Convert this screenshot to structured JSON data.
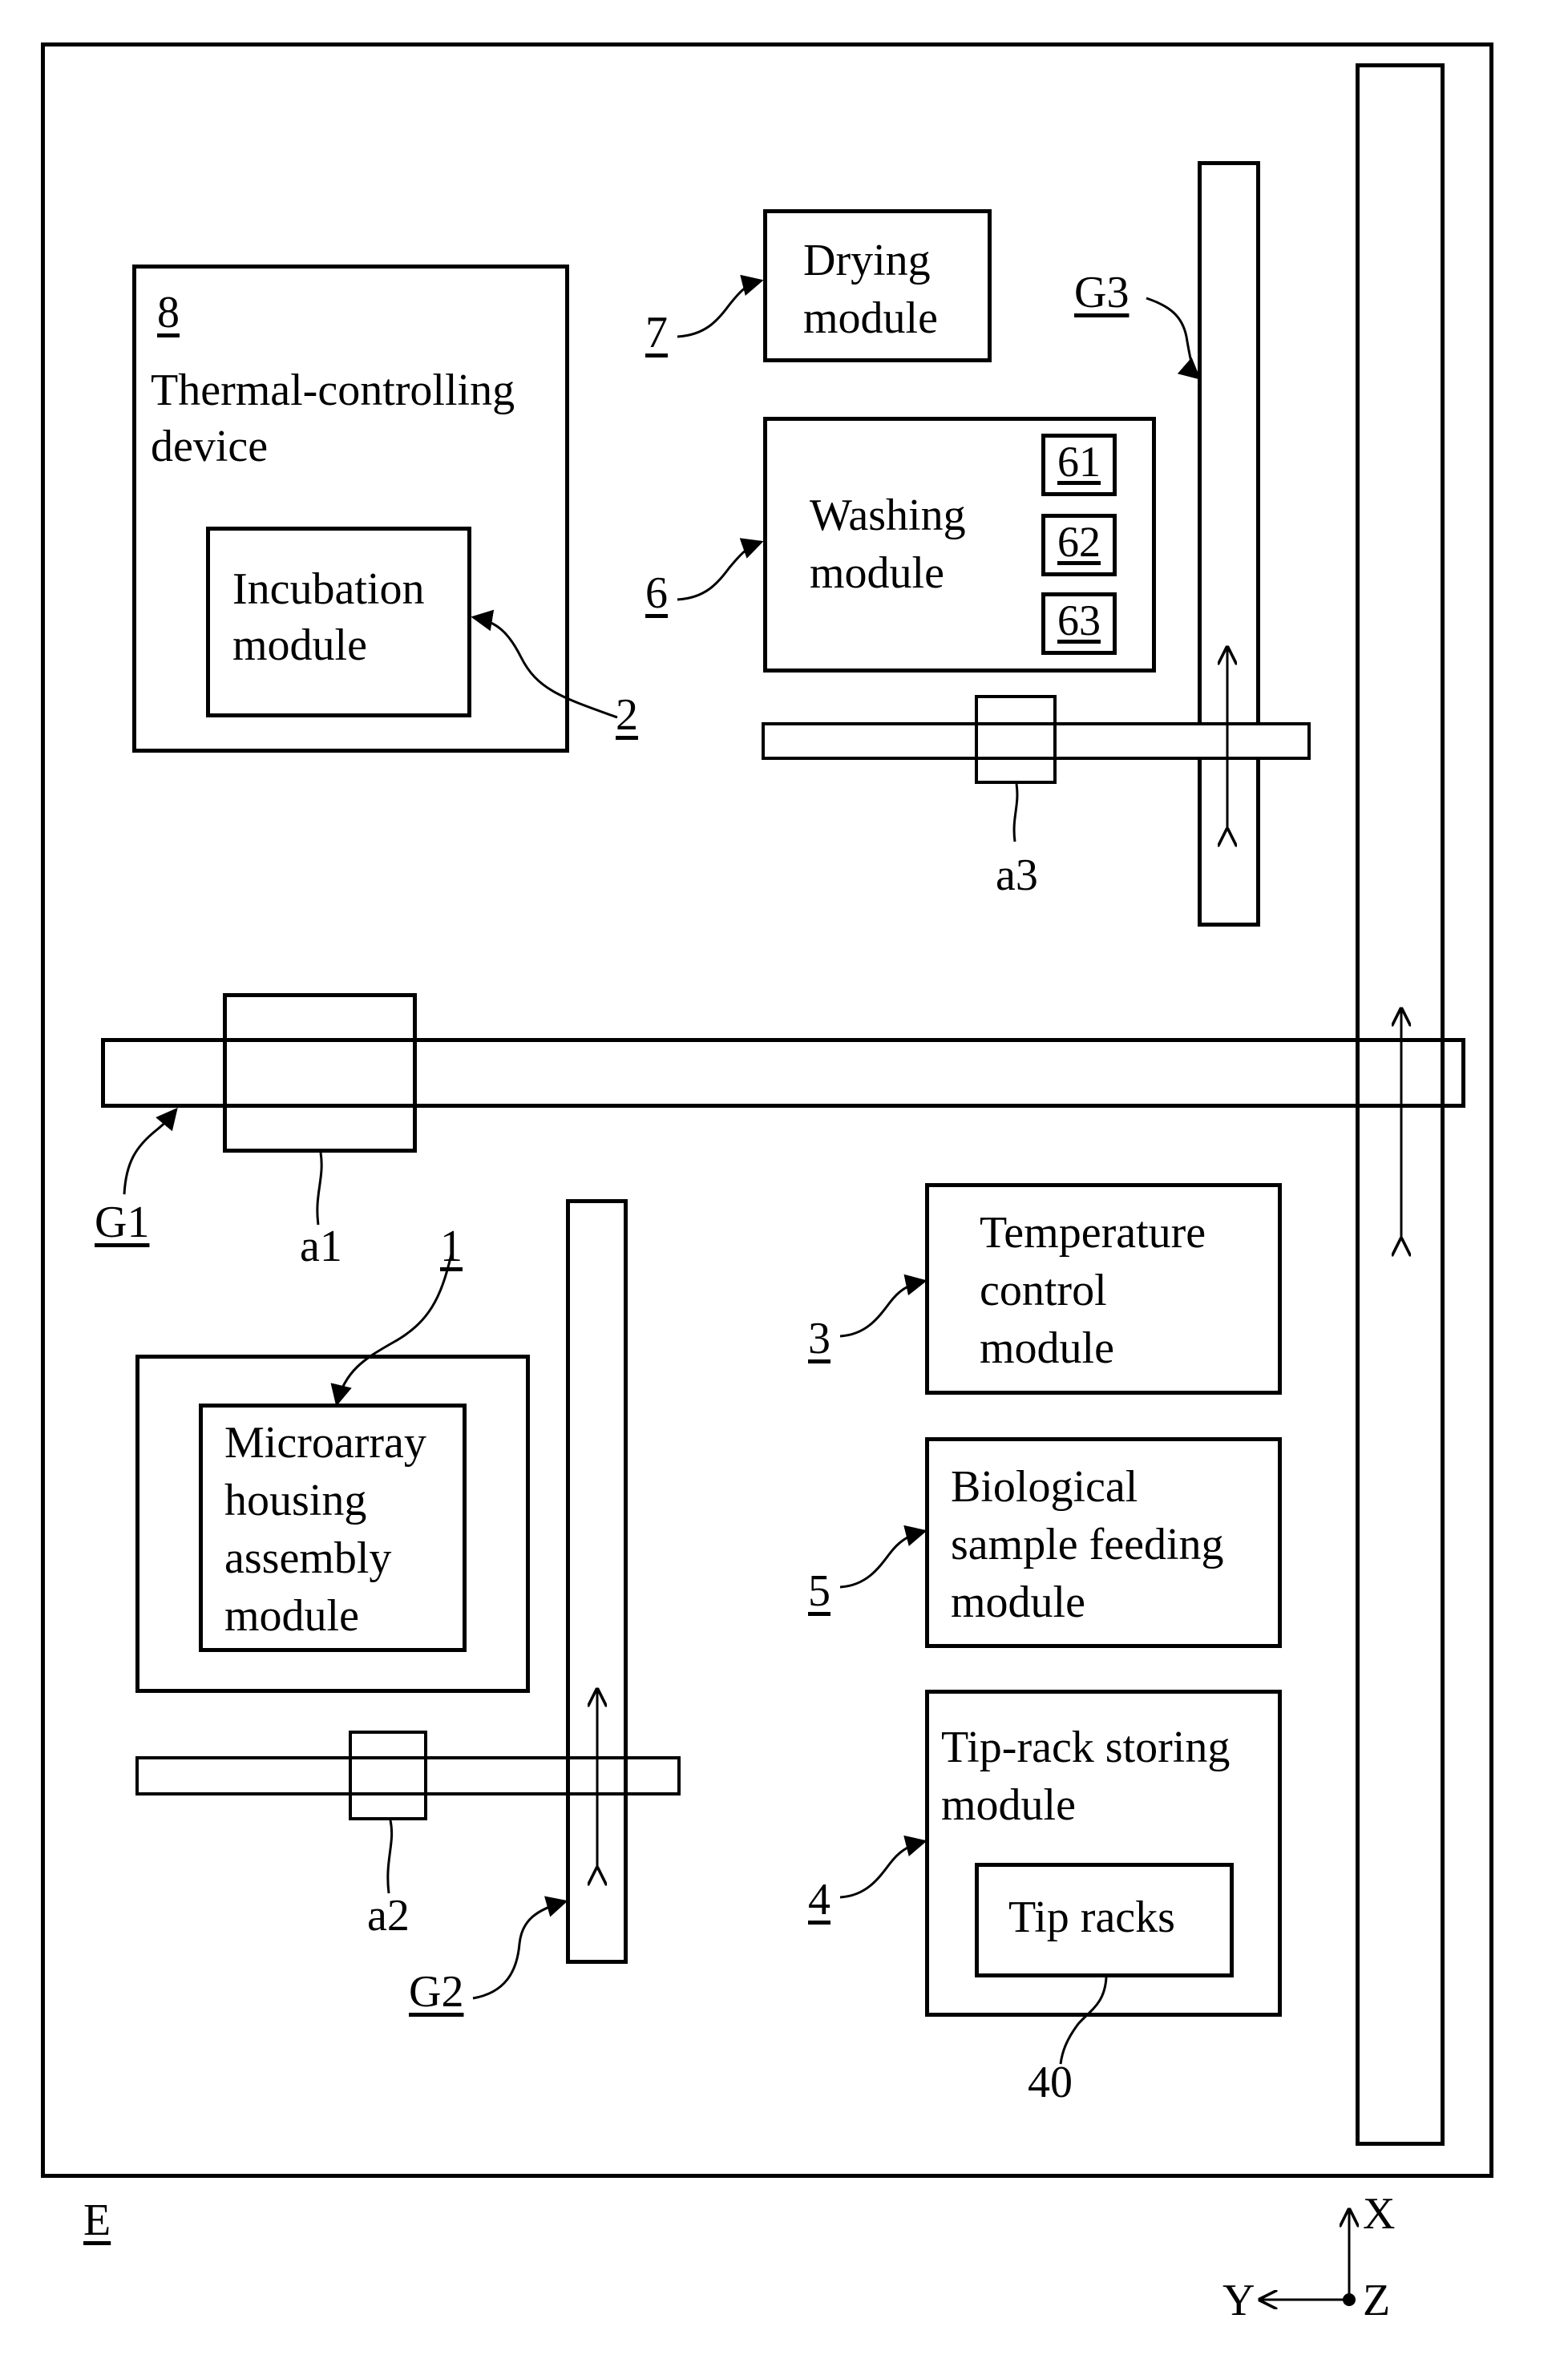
{
  "figure": {
    "enclosure_label": "E",
    "axes": {
      "x": "X",
      "y": "Y",
      "z": "Z"
    }
  },
  "modules": {
    "thermal": {
      "ref": "8",
      "title_lines": [
        "Thermal-controlling",
        "device"
      ]
    },
    "incubation": {
      "ref": "2",
      "title_lines": [
        "Incubation",
        "module"
      ]
    },
    "drying": {
      "ref": "7",
      "title_lines": [
        "Drying",
        "module"
      ]
    },
    "washing": {
      "ref": "6",
      "title_lines": [
        "Washing",
        "module"
      ],
      "units": [
        "61",
        "62",
        "63"
      ]
    },
    "temperature": {
      "ref": "3",
      "title_lines": [
        "Temperature",
        "control",
        "module"
      ]
    },
    "biological": {
      "ref": "5",
      "title_lines": [
        "Biological",
        "sample feeding",
        "module"
      ]
    },
    "tiprack": {
      "ref": "4",
      "title_lines": [
        "Tip-rack storing",
        "module"
      ],
      "inner": {
        "ref": "40",
        "label": "Tip racks"
      }
    },
    "microarray": {
      "ref": "1",
      "title_lines": [
        "Microarray",
        "housing",
        "assembly",
        "module"
      ]
    }
  },
  "gantries": {
    "g1": {
      "ref": "G1",
      "carriage": "a1"
    },
    "g2": {
      "ref": "G2",
      "carriage": "a2"
    },
    "g3": {
      "ref": "G3",
      "carriage": "a3"
    }
  }
}
